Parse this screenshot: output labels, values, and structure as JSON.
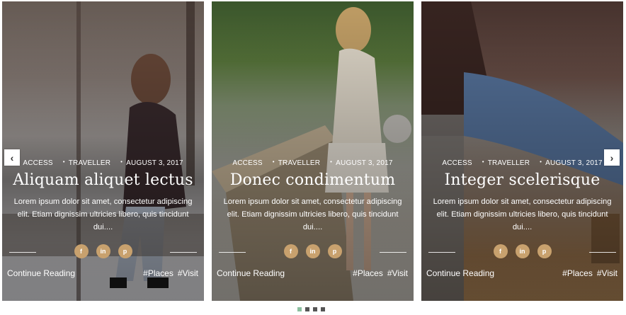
{
  "slider": {
    "cards": [
      {
        "meta": {
          "category": "ACCESS",
          "tag": "TRAVELLER",
          "date": "AUGUST 3, 2017"
        },
        "title": "Aliquam aliquet lectus",
        "excerpt": "Lorem ipsum dolor sit amet, consectetur adipiscing elit. Etiam dignissim ultricies libero, quis tincidunt dui....",
        "social": {
          "facebook": "f",
          "linkedin": "in",
          "pinterest": "p"
        },
        "cta": "Continue Reading",
        "tags": [
          "#Places",
          "#Visit"
        ]
      },
      {
        "meta": {
          "category": "ACCESS",
          "tag": "TRAVELLER",
          "date": "AUGUST 3, 2017"
        },
        "title": "Donec condimentum",
        "excerpt": "Lorem ipsum dolor sit amet, consectetur adipiscing elit. Etiam dignissim ultricies libero, quis tincidunt dui....",
        "social": {
          "facebook": "f",
          "linkedin": "in",
          "pinterest": "p"
        },
        "cta": "Continue Reading",
        "tags": [
          "#Places",
          "#Visit"
        ]
      },
      {
        "meta": {
          "category": "ACCESS",
          "tag": "TRAVELLER",
          "date": "AUGUST 3, 2017"
        },
        "title": "Integer scelerisque",
        "excerpt": "Lorem ipsum dolor sit amet, consectetur adipiscing elit. Etiam dignissim ultricies libero, quis tincidunt dui....",
        "social": {
          "facebook": "f",
          "linkedin": "in",
          "pinterest": "p"
        },
        "cta": "Continue Reading",
        "tags": [
          "#Places",
          "#Visit"
        ]
      }
    ],
    "nav": {
      "prev": "‹",
      "next": "›"
    },
    "pagination": {
      "count": 4,
      "active": 0
    }
  },
  "colors": {
    "social_bg": "#c8a16e",
    "dot_active": "#8bbf9f",
    "dot": "#555555"
  }
}
